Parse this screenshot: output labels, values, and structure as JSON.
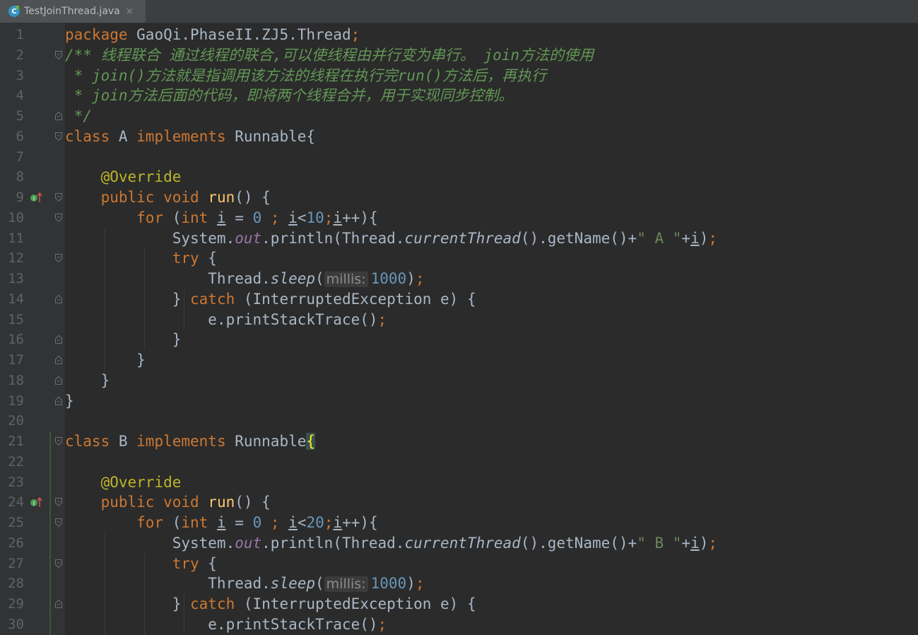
{
  "tab": {
    "filename": "TestJoinThread.java",
    "icon": "java-class-icon",
    "close": "×"
  },
  "lines": [
    {
      "n": "1",
      "segs": [
        {
          "t": "package ",
          "c": "kw"
        },
        {
          "t": "GaoQi.PhaseII.ZJ5.Thread"
        },
        {
          "t": ";",
          "c": "kw"
        }
      ]
    },
    {
      "n": "2",
      "fold": "open",
      "segs": [
        {
          "t": "/** 线程联合 通过线程的联合,可以使线程由并行变为串行。 join方法的使用",
          "c": "cmt"
        }
      ]
    },
    {
      "n": "3",
      "segs": [
        {
          "t": " * join()方法就是指调用该方法的线程在执行完run()方法后，再执行",
          "c": "cmt"
        }
      ]
    },
    {
      "n": "4",
      "segs": [
        {
          "t": " * join方法后面的代码，即将两个线程合并，用于实现同步控制。",
          "c": "cmt"
        }
      ]
    },
    {
      "n": "5",
      "fold": "close",
      "segs": [
        {
          "t": " */",
          "c": "cmt"
        }
      ]
    },
    {
      "n": "6",
      "fold": "open",
      "segs": [
        {
          "t": "class ",
          "c": "kw"
        },
        {
          "t": "A "
        },
        {
          "t": "implements ",
          "c": "kw"
        },
        {
          "t": "Runnable{"
        }
      ]
    },
    {
      "n": "7",
      "segs": []
    },
    {
      "n": "8",
      "segs": [
        {
          "t": "    "
        },
        {
          "t": "@Override",
          "c": "ann"
        }
      ]
    },
    {
      "n": "9",
      "impl": true,
      "fold": "open",
      "segs": [
        {
          "t": "    "
        },
        {
          "t": "public void ",
          "c": "kw"
        },
        {
          "t": "run",
          "c": "fn"
        },
        {
          "t": "() {"
        }
      ]
    },
    {
      "n": "10",
      "fold": "open",
      "segs": [
        {
          "t": "        "
        },
        {
          "t": "for ",
          "c": "kw"
        },
        {
          "t": "("
        },
        {
          "t": "int ",
          "c": "kw"
        },
        {
          "t": "i",
          "c": "ul"
        },
        {
          "t": " = "
        },
        {
          "t": "0 ",
          "c": "num"
        },
        {
          "t": "; ",
          "c": "kw"
        },
        {
          "t": "i",
          "c": "ul"
        },
        {
          "t": "<"
        },
        {
          "t": "10",
          "c": "num"
        },
        {
          "t": ";",
          "c": "kw"
        },
        {
          "t": "i",
          "c": "ul"
        },
        {
          "t": "++){"
        }
      ]
    },
    {
      "n": "11",
      "segs": [
        {
          "t": "            System."
        },
        {
          "t": "out",
          "c": "fld"
        },
        {
          "t": ".println(Thread."
        },
        {
          "t": "currentThread",
          "c": "stat"
        },
        {
          "t": "().getName()+"
        },
        {
          "t": "\" A \"",
          "c": "str"
        },
        {
          "t": "+"
        },
        {
          "t": "i",
          "c": "ul"
        },
        {
          "t": ")"
        },
        {
          "t": ";",
          "c": "kw"
        }
      ]
    },
    {
      "n": "12",
      "fold": "open",
      "segs": [
        {
          "t": "            "
        },
        {
          "t": "try ",
          "c": "kw"
        },
        {
          "t": "{"
        }
      ]
    },
    {
      "n": "13",
      "segs": [
        {
          "t": "                Thread."
        },
        {
          "t": "sleep",
          "c": "stat"
        },
        {
          "t": "("
        },
        {
          "t": "millis:",
          "c": "hint"
        },
        {
          "t": "1000",
          "c": "num"
        },
        {
          "t": ")"
        },
        {
          "t": ";",
          "c": "kw"
        }
      ]
    },
    {
      "n": "14",
      "fold": "close",
      "segs": [
        {
          "t": "            } "
        },
        {
          "t": "catch ",
          "c": "kw"
        },
        {
          "t": "(InterruptedException e) {"
        }
      ]
    },
    {
      "n": "15",
      "segs": [
        {
          "t": "                e.printStackTrace()"
        },
        {
          "t": ";",
          "c": "kw"
        }
      ]
    },
    {
      "n": "16",
      "fold": "close",
      "segs": [
        {
          "t": "            }"
        }
      ]
    },
    {
      "n": "17",
      "fold": "close",
      "segs": [
        {
          "t": "        }"
        }
      ]
    },
    {
      "n": "18",
      "fold": "close",
      "segs": [
        {
          "t": "    }"
        }
      ]
    },
    {
      "n": "19",
      "fold": "close",
      "segs": [
        {
          "t": "}"
        }
      ]
    },
    {
      "n": "20",
      "segs": []
    },
    {
      "n": "21",
      "fold": "open",
      "segs": [
        {
          "t": "class ",
          "c": "kw"
        },
        {
          "t": "B "
        },
        {
          "t": "implements ",
          "c": "kw"
        },
        {
          "t": "Runnable"
        },
        {
          "t": "{",
          "c": "brace-hl"
        }
      ]
    },
    {
      "n": "22",
      "segs": []
    },
    {
      "n": "23",
      "segs": [
        {
          "t": "    "
        },
        {
          "t": "@Override",
          "c": "ann"
        }
      ]
    },
    {
      "n": "24",
      "impl": true,
      "fold": "open",
      "segs": [
        {
          "t": "    "
        },
        {
          "t": "public void ",
          "c": "kw"
        },
        {
          "t": "run",
          "c": "fn"
        },
        {
          "t": "() {"
        }
      ]
    },
    {
      "n": "25",
      "fold": "open",
      "segs": [
        {
          "t": "        "
        },
        {
          "t": "for ",
          "c": "kw"
        },
        {
          "t": "("
        },
        {
          "t": "int ",
          "c": "kw"
        },
        {
          "t": "i",
          "c": "ul"
        },
        {
          "t": " = "
        },
        {
          "t": "0 ",
          "c": "num"
        },
        {
          "t": "; ",
          "c": "kw"
        },
        {
          "t": "i",
          "c": "ul"
        },
        {
          "t": "<"
        },
        {
          "t": "20",
          "c": "num"
        },
        {
          "t": ";",
          "c": "kw"
        },
        {
          "t": "i",
          "c": "ul"
        },
        {
          "t": "++){"
        }
      ]
    },
    {
      "n": "26",
      "segs": [
        {
          "t": "            System."
        },
        {
          "t": "out",
          "c": "fld"
        },
        {
          "t": ".println(Thread."
        },
        {
          "t": "currentThread",
          "c": "stat"
        },
        {
          "t": "().getName()+"
        },
        {
          "t": "\" B \"",
          "c": "str"
        },
        {
          "t": "+"
        },
        {
          "t": "i",
          "c": "ul"
        },
        {
          "t": ")"
        },
        {
          "t": ";",
          "c": "kw"
        }
      ]
    },
    {
      "n": "27",
      "fold": "open",
      "segs": [
        {
          "t": "            "
        },
        {
          "t": "try ",
          "c": "kw"
        },
        {
          "t": "{"
        }
      ]
    },
    {
      "n": "28",
      "segs": [
        {
          "t": "                Thread."
        },
        {
          "t": "sleep",
          "c": "stat"
        },
        {
          "t": "("
        },
        {
          "t": "millis:",
          "c": "hint"
        },
        {
          "t": "1000",
          "c": "num"
        },
        {
          "t": ")"
        },
        {
          "t": ";",
          "c": "kw"
        }
      ]
    },
    {
      "n": "29",
      "fold": "close",
      "segs": [
        {
          "t": "            } "
        },
        {
          "t": "catch ",
          "c": "kw"
        },
        {
          "t": "(InterruptedException e) {"
        }
      ]
    },
    {
      "n": "30",
      "segs": [
        {
          "t": "                e.printStackTrace()"
        },
        {
          "t": ";",
          "c": "kw"
        }
      ]
    }
  ]
}
